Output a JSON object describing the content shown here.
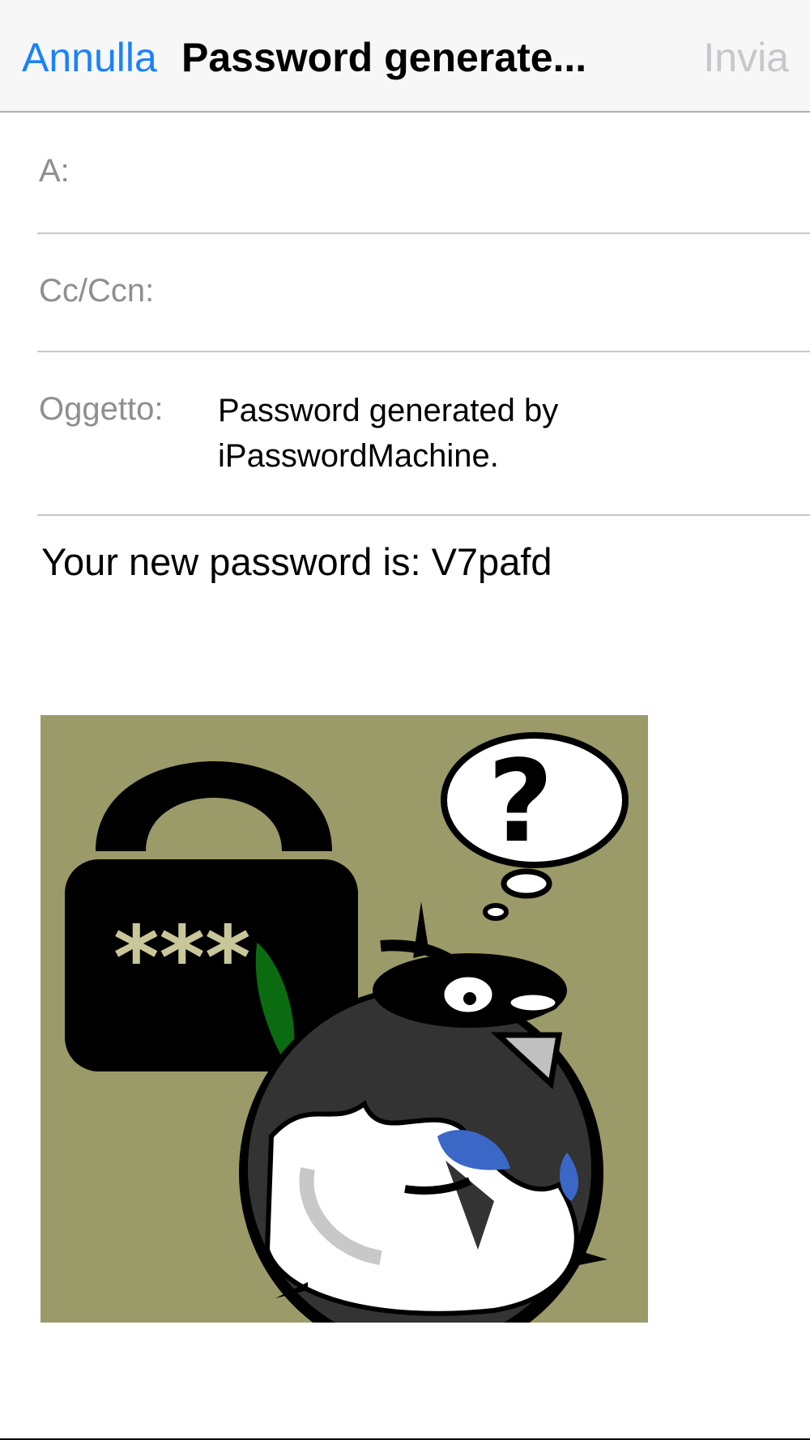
{
  "nav": {
    "cancel_label": "Annulla",
    "title": "Password generate...",
    "send_label": "Invia"
  },
  "fields": {
    "to_label": "A:",
    "cc_label": "Cc/Ccn:",
    "subject_label": "Oggetto:",
    "subject_value": "Password generated by iPasswordMachine."
  },
  "message": {
    "body": "Your new password is: V7pafd"
  },
  "attachment": {
    "lock_mask": "***",
    "bubble_symbol": "?",
    "background_color": "#9b9a69",
    "icon": "lock-and-bird-illustration"
  },
  "colors": {
    "accent": "#1a82fb",
    "disabled": "#c7c7cc",
    "label": "#8e8e93"
  }
}
